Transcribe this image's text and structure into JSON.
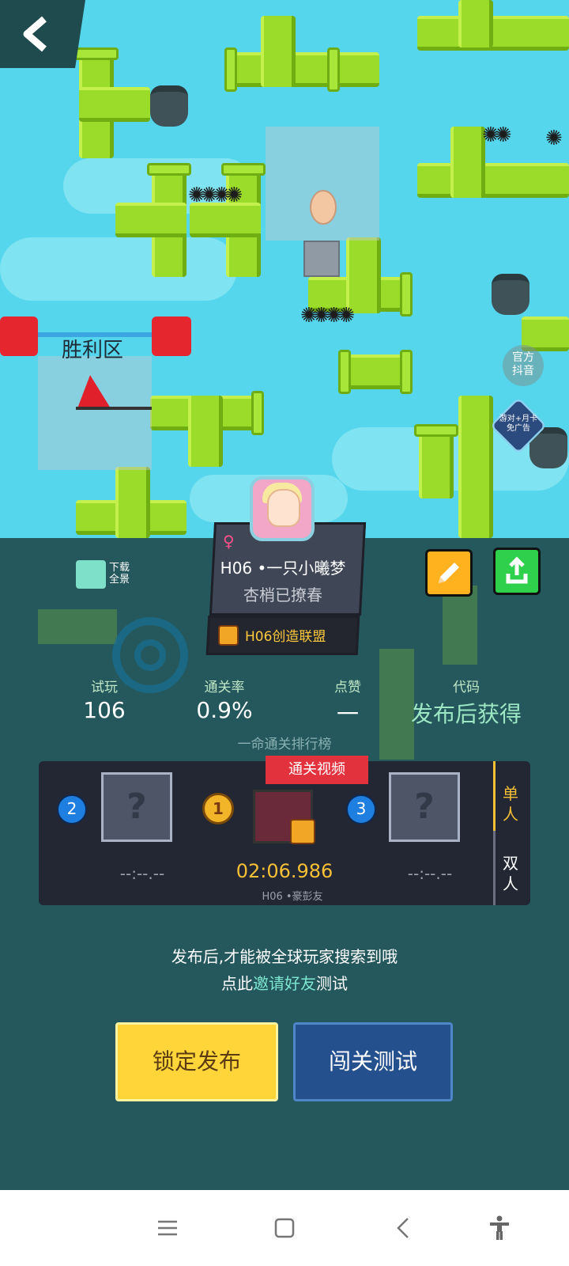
{
  "map": {
    "victory_zone_label": "胜利区",
    "official_douyin": "官方\n抖音",
    "promo_badge": "游对+月卡\n免广告"
  },
  "toolbar": {
    "download_label": "下载\n全景"
  },
  "creator": {
    "name": "H06 •一只小曦梦",
    "subtitle": "杏梢已撩春",
    "guild": "H06创造联盟"
  },
  "stats": [
    {
      "label": "试玩",
      "value": "106"
    },
    {
      "label": "通关率",
      "value": "0.9%"
    },
    {
      "label": "点赞",
      "value": "一"
    },
    {
      "label": "代码",
      "value": "发布后获得"
    }
  ],
  "ranking": {
    "title": "一命通关排行榜",
    "video_tag": "通关视频",
    "entries": [
      {
        "rank": "2",
        "time": "--:--.--"
      },
      {
        "rank": "1",
        "time": "02:06.986",
        "player": "H06 •豪彭友"
      },
      {
        "rank": "3",
        "time": "--:--.--"
      }
    ],
    "tabs": {
      "single": "单\n人",
      "double": "双\n人"
    }
  },
  "publish_note": {
    "line1": "发布后,才能被全球玩家搜索到哦",
    "line2_prefix": "点此",
    "line2_link": "邀请好友",
    "line2_suffix": "测试"
  },
  "buttons": {
    "lock_publish": "锁定发布",
    "test_play": "闯关测试"
  }
}
